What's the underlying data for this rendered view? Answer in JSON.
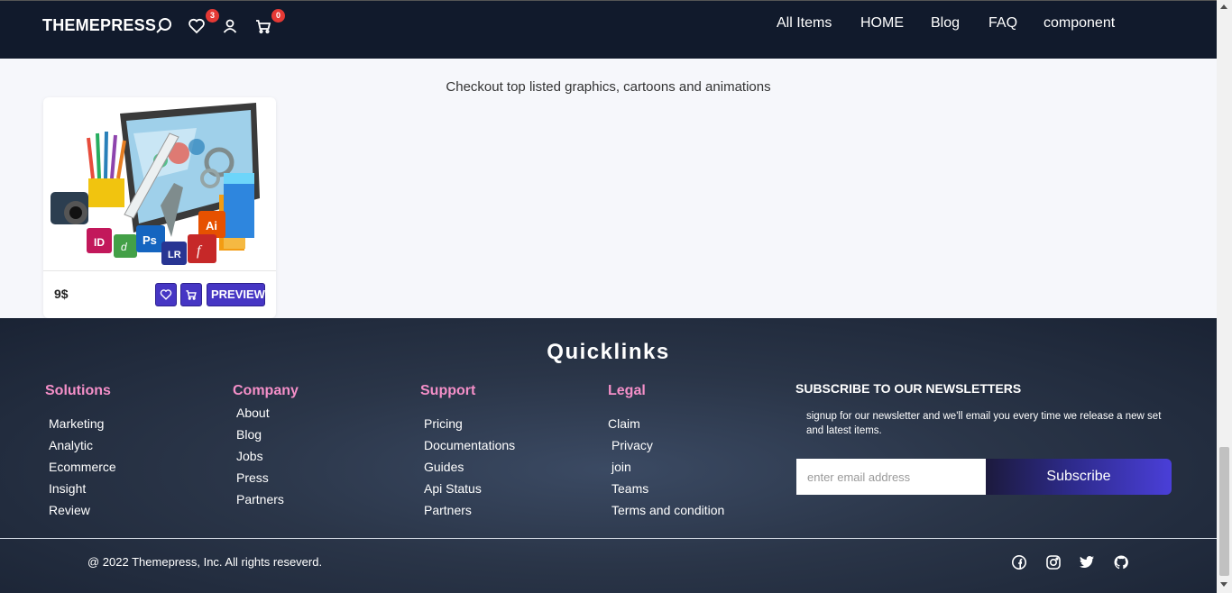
{
  "header": {
    "brand": "THEMEPRESS",
    "wishlist_count": "3",
    "cart_count": "0",
    "nav": [
      "All Items",
      "HOME",
      "Blog",
      "FAQ",
      "component"
    ]
  },
  "main": {
    "subtitle": "Checkout top listed graphics, cartoons and animations",
    "product": {
      "price": "9$",
      "preview_label": "PREVIEW",
      "image_badges": [
        "ID",
        "Ps",
        "LR",
        "Ai"
      ]
    }
  },
  "footer": {
    "title": "Quicklinks",
    "columns": [
      {
        "heading": "Solutions",
        "links": [
          "Marketing",
          "Analytic",
          "Ecommerce",
          "Insight",
          "Review"
        ]
      },
      {
        "heading": "Company",
        "links": [
          "About",
          "Blog",
          "Jobs",
          "Press",
          "Partners"
        ]
      },
      {
        "heading": "Support",
        "links": [
          "Pricing",
          "Documentations",
          "Guides",
          "Api Status",
          "Partners"
        ]
      },
      {
        "heading": "Legal",
        "links": [
          "Claim",
          "Privacy",
          "join",
          "Teams",
          "Terms and condition"
        ]
      }
    ],
    "newsletter": {
      "heading": "SUBSCRIBE TO OUR NEWSLETTERS",
      "text": "signup for our newsletter and we'll email you every time we release a new set and latest items.",
      "placeholder": "enter email address",
      "button": "Subscribe"
    },
    "copyright": "@ 2022 Themepress, Inc. All rights reseverd.",
    "social": [
      "facebook-icon",
      "instagram-icon",
      "twitter-icon",
      "github-icon"
    ]
  },
  "colors": {
    "header_bg": "#111a2c",
    "accent": "#4636c4",
    "footer_heading": "#f48fc8",
    "badge": "#e53935"
  }
}
